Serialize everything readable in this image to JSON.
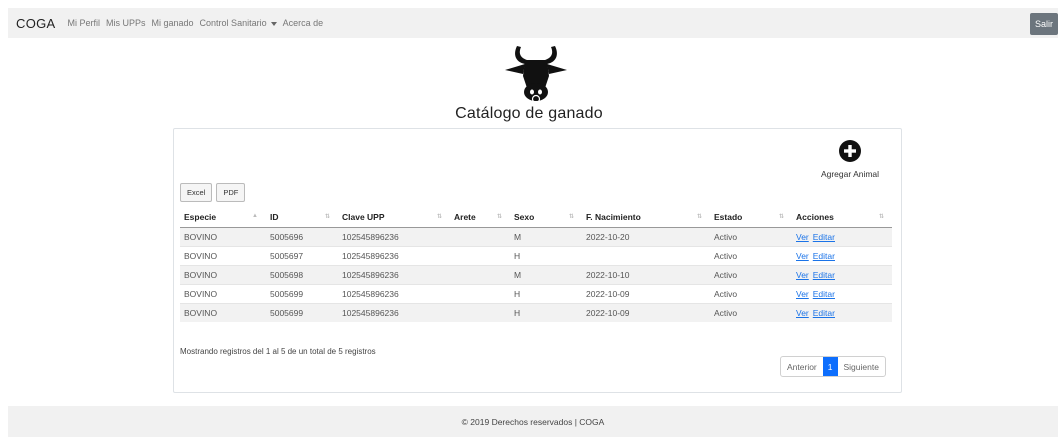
{
  "nav": {
    "brand": "COGA",
    "items": [
      "Mi Perfil",
      "Mis UPPs",
      "Mi ganado",
      "Control Sanitario",
      "Acerca de"
    ],
    "logout": "Salir"
  },
  "page": {
    "title": "Catálogo de ganado",
    "add_label": "Agregar Animal"
  },
  "export": {
    "excel": "Excel",
    "pdf": "PDF"
  },
  "table": {
    "headers": [
      "Especie",
      "ID",
      "Clave UPP",
      "Arete",
      "Sexo",
      "F. Nacimiento",
      "Estado",
      "Acciones"
    ],
    "rows": [
      [
        "BOVINO",
        "5005696",
        "102545896236",
        "",
        "M",
        "2022-10-20",
        "Activo"
      ],
      [
        "BOVINO",
        "5005697",
        "102545896236",
        "",
        "H",
        "",
        "Activo"
      ],
      [
        "BOVINO",
        "5005698",
        "102545896236",
        "",
        "M",
        "2022-10-10",
        "Activo"
      ],
      [
        "BOVINO",
        "5005699",
        "102545896236",
        "",
        "H",
        "2022-10-09",
        "Activo"
      ],
      [
        "BOVINO",
        "5005699",
        "102545896236",
        "",
        "H",
        "2022-10-09",
        "Activo"
      ]
    ],
    "action_view": "Ver",
    "action_edit": "Editar"
  },
  "info": "Mostrando registros del 1 al 5 de un total de 5 registros",
  "pagination": {
    "prev": "Anterior",
    "current": "1",
    "next": "Siguiente"
  },
  "footer": "© 2019 Derechos reservados | COGA",
  "colors": {
    "accent": "#0d6efd",
    "navbar_bg": "#f1f1f1",
    "link": "#1a73e8"
  }
}
